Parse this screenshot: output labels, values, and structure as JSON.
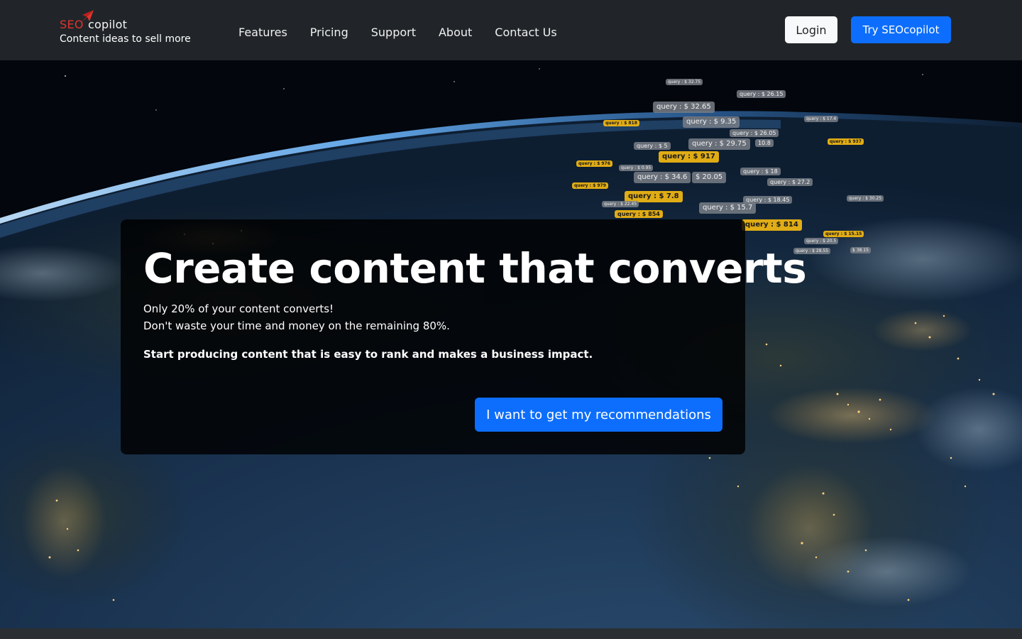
{
  "brand": {
    "logo_seo": "SEO",
    "logo_copilot": "copilot",
    "tagline": "Content ideas to sell more"
  },
  "nav": {
    "items": [
      {
        "label": "Features"
      },
      {
        "label": "Pricing"
      },
      {
        "label": "Support"
      },
      {
        "label": "About"
      },
      {
        "label": "Contact Us"
      }
    ]
  },
  "header_actions": {
    "login_label": "Login",
    "try_label": "Try SEOcopilot"
  },
  "hero": {
    "title": "Create content that converts",
    "line1": "Only 20% of your content converts!",
    "line2": "Don't waste your time and money on the remaining 80%.",
    "emphasis": "Start producing content that is easy to rank and makes a business impact.",
    "cta_label": "I want to get my recommendations"
  },
  "query_tags": [
    {
      "text": "query : $ 32.65",
      "style": "grey"
    },
    {
      "text": "query : $ 26.15",
      "style": "grey"
    },
    {
      "text": "query : $ 9.35",
      "style": "grey"
    },
    {
      "text": "query : $ 818",
      "style": "yellow"
    },
    {
      "text": "query : $ 26.05",
      "style": "grey"
    },
    {
      "text": "query : $ 29.75",
      "style": "grey"
    },
    {
      "text": "10.8",
      "style": "grey"
    },
    {
      "text": "query : $ 5",
      "style": "grey"
    },
    {
      "text": "query : $ 917",
      "style": "yellow"
    },
    {
      "text": "query : $ 937",
      "style": "yellow"
    },
    {
      "text": "query : $ 34.6",
      "style": "grey"
    },
    {
      "text": "$ 20.05",
      "style": "grey"
    },
    {
      "text": "query : $ 18",
      "style": "grey"
    },
    {
      "text": "query : $ 27.2",
      "style": "grey"
    },
    {
      "text": "query : $ 7.8",
      "style": "yellow"
    },
    {
      "text": "query : $ 18.45",
      "style": "grey"
    },
    {
      "text": "query : $ 15.7",
      "style": "grey"
    },
    {
      "text": "query : $ 854",
      "style": "yellow"
    },
    {
      "text": "query : $ 814",
      "style": "yellow"
    },
    {
      "text": "query : $ 15.15",
      "style": "yellow"
    },
    {
      "text": "query : $ 20.5",
      "style": "grey"
    },
    {
      "text": "query : $ 28.55",
      "style": "grey"
    },
    {
      "text": "$ 38.15",
      "style": "grey"
    },
    {
      "text": "query : $ 32.75",
      "style": "grey"
    },
    {
      "text": "query : $ 22.45",
      "style": "grey"
    },
    {
      "text": "query : $ 0.95",
      "style": "grey"
    },
    {
      "text": "query : $ 17.4",
      "style": "grey"
    },
    {
      "text": "query : $ 30.25",
      "style": "grey"
    },
    {
      "text": "query : $ 976",
      "style": "yellow"
    },
    {
      "text": "query : $ 979",
      "style": "yellow"
    }
  ],
  "colors": {
    "navbar_bg": "#212529",
    "primary": "#0d6efd",
    "logo_red": "#e0342f",
    "tag_yellow": "#ecb414"
  }
}
